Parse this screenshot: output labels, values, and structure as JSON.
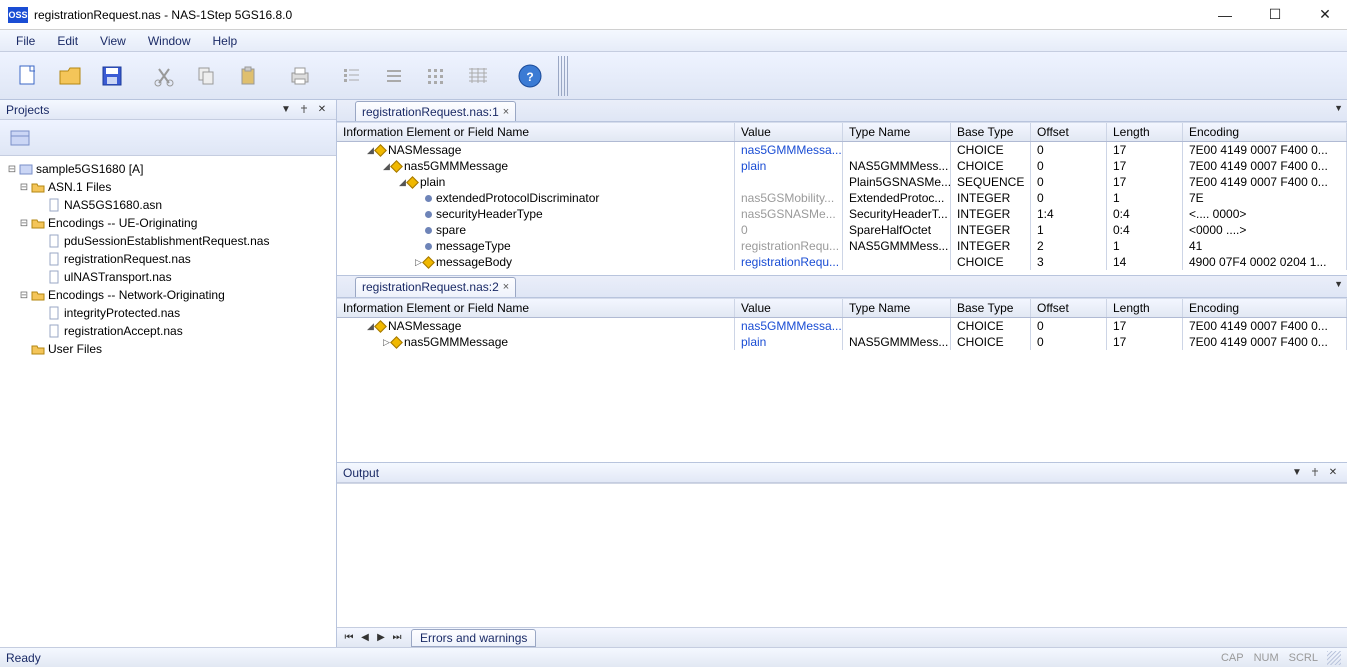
{
  "window": {
    "app_icon_text": "OSS",
    "title": "registrationRequest.nas - NAS-1Step 5GS16.8.0"
  },
  "menu": [
    "File",
    "Edit",
    "View",
    "Window",
    "Help"
  ],
  "projects": {
    "title": "Projects",
    "tree": [
      {
        "indent": 0,
        "exp": "minus",
        "icon": "project",
        "label": "sample5GS1680 [A]"
      },
      {
        "indent": 1,
        "exp": "minus",
        "icon": "folder",
        "label": "ASN.1 Files"
      },
      {
        "indent": 2,
        "exp": "",
        "icon": "file",
        "label": "NAS5GS1680.asn"
      },
      {
        "indent": 1,
        "exp": "minus",
        "icon": "folder",
        "label": "Encodings -- UE-Originating"
      },
      {
        "indent": 2,
        "exp": "",
        "icon": "file",
        "label": "pduSessionEstablishmentRequest.nas"
      },
      {
        "indent": 2,
        "exp": "",
        "icon": "file",
        "label": "registrationRequest.nas"
      },
      {
        "indent": 2,
        "exp": "",
        "icon": "file",
        "label": "ulNASTransport.nas"
      },
      {
        "indent": 1,
        "exp": "minus",
        "icon": "folder",
        "label": "Encodings -- Network-Originating"
      },
      {
        "indent": 2,
        "exp": "",
        "icon": "file",
        "label": "integrityProtected.nas"
      },
      {
        "indent": 2,
        "exp": "",
        "icon": "file",
        "label": "registrationAccept.nas"
      },
      {
        "indent": 1,
        "exp": "",
        "icon": "folder",
        "label": "User Files"
      }
    ]
  },
  "grid_headers": [
    "Information Element or Field Name",
    "Value",
    "Type Name",
    "Base Type",
    "Offset",
    "Length",
    "Encoding"
  ],
  "pane1": {
    "tab": "registrationRequest.nas:1",
    "rows": [
      {
        "indent": 0,
        "exp": "open",
        "icon": "diamond",
        "name": "NASMessage",
        "value": "nas5GMMMessa...",
        "valcls": "val-blue",
        "type": "",
        "base": "CHOICE",
        "off": "0",
        "len": "17",
        "enc": "7E00 4149 0007 F400 0..."
      },
      {
        "indent": 1,
        "exp": "open",
        "icon": "diamond",
        "name": "nas5GMMMessage",
        "value": "plain",
        "valcls": "val-blue",
        "type": "NAS5GMMMess...",
        "base": "CHOICE",
        "off": "0",
        "len": "17",
        "enc": "7E00 4149 0007 F400 0..."
      },
      {
        "indent": 2,
        "exp": "open",
        "icon": "diamond",
        "name": "plain",
        "value": "",
        "valcls": "",
        "type": "Plain5GSNASMe...",
        "base": "SEQUENCE",
        "off": "0",
        "len": "17",
        "enc": "7E00 4149 0007 F400 0..."
      },
      {
        "indent": 3,
        "exp": "",
        "icon": "bullet",
        "name": "extendedProtocolDiscriminator",
        "value": "nas5GSMobility...",
        "valcls": "val-gray",
        "type": "ExtendedProtoc...",
        "base": "INTEGER",
        "off": "0",
        "len": "1",
        "enc": "7E"
      },
      {
        "indent": 3,
        "exp": "",
        "icon": "bullet",
        "name": "securityHeaderType",
        "value": "nas5GSNASMe...",
        "valcls": "val-gray",
        "type": "SecurityHeaderT...",
        "base": "INTEGER",
        "off": "1:4",
        "len": "0:4",
        "enc": "<.... 0000>"
      },
      {
        "indent": 3,
        "exp": "",
        "icon": "bullet",
        "name": "spare",
        "value": "0",
        "valcls": "val-gray",
        "type": "SpareHalfOctet",
        "base": "INTEGER",
        "off": "1",
        "len": "0:4",
        "enc": "<0000 ....>"
      },
      {
        "indent": 3,
        "exp": "",
        "icon": "bullet",
        "name": "messageType",
        "value": "registrationRequ...",
        "valcls": "val-gray",
        "type": "NAS5GMMMess...",
        "base": "INTEGER",
        "off": "2",
        "len": "1",
        "enc": "41"
      },
      {
        "indent": 3,
        "exp": "closed",
        "icon": "diamond",
        "name": "messageBody",
        "value": "registrationRequ...",
        "valcls": "val-blue",
        "type": "",
        "base": "CHOICE",
        "off": "3",
        "len": "14",
        "enc": "4900 07F4 0002 0204 1..."
      }
    ]
  },
  "pane2": {
    "tab": "registrationRequest.nas:2",
    "rows": [
      {
        "indent": 0,
        "exp": "open",
        "icon": "diamond",
        "name": "NASMessage",
        "value": "nas5GMMMessa...",
        "valcls": "val-blue",
        "type": "",
        "base": "CHOICE",
        "off": "0",
        "len": "17",
        "enc": "7E00 4149 0007 F400 0..."
      },
      {
        "indent": 1,
        "exp": "closed",
        "icon": "diamond",
        "name": "nas5GMMMessage",
        "value": "plain",
        "valcls": "val-blue",
        "type": "NAS5GMMMess...",
        "base": "CHOICE",
        "off": "0",
        "len": "17",
        "enc": "7E00 4149 0007 F400 0..."
      }
    ]
  },
  "output": {
    "title": "Output",
    "errors_tab": "Errors and warnings"
  },
  "status": {
    "ready": "Ready",
    "cap": "CAP",
    "num": "NUM",
    "scrl": "SCRL"
  }
}
